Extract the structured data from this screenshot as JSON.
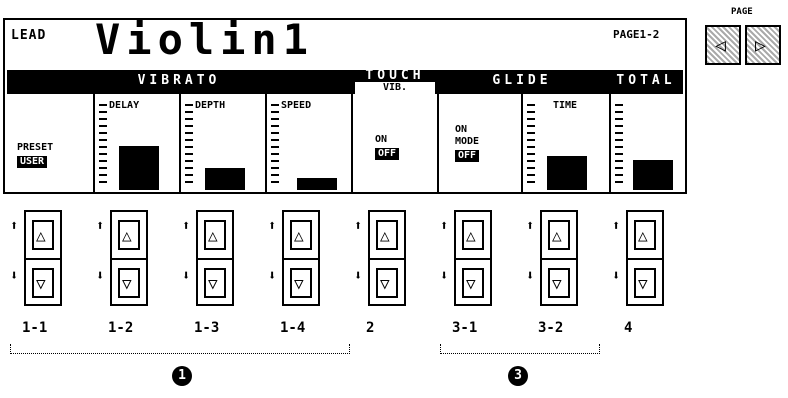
{
  "display": {
    "lead_label": "LEAD",
    "voice_name": "Violin1",
    "page_indicator": "PAGE1-2",
    "sections": {
      "vibrato": "VIBRATO",
      "touch_vib": "TOUCH",
      "touch_vib_sub": "VIB.",
      "glide": "GLIDE",
      "total": "TOTAL"
    },
    "vibrato": {
      "preset_label": "PRESET",
      "preset_value": "USER",
      "delay_label": "DELAY",
      "depth_label": "DEPTH",
      "speed_label": "SPEED",
      "delay_level": 0.55,
      "depth_level": 0.28,
      "speed_level": 0.15
    },
    "touch": {
      "on_label": "ON",
      "off_value": "OFF"
    },
    "glide": {
      "on_label": "ON",
      "mode_label": "MODE",
      "mode_value": "OFF",
      "time_label": "TIME",
      "time_level": 0.42
    },
    "total": {
      "level": 0.38
    }
  },
  "page_buttons": {
    "caption": "PAGE",
    "left_glyph": "◁",
    "right_glyph": "▷"
  },
  "controls": [
    {
      "label": "1-1"
    },
    {
      "label": "1-2"
    },
    {
      "label": "1-3"
    },
    {
      "label": "1-4"
    },
    {
      "label": "2"
    },
    {
      "label": "3-1"
    },
    {
      "label": "3-2"
    },
    {
      "label": "4"
    }
  ],
  "groups": {
    "group1": "1",
    "group3": "3"
  },
  "glyphs": {
    "up_arrow": "⬆",
    "down_arrow": "⬇",
    "up_tri": "△",
    "down_tri": "▽"
  },
  "number_marks": {
    "1": "1",
    "2": "2",
    "3": "3",
    "4": "4"
  }
}
